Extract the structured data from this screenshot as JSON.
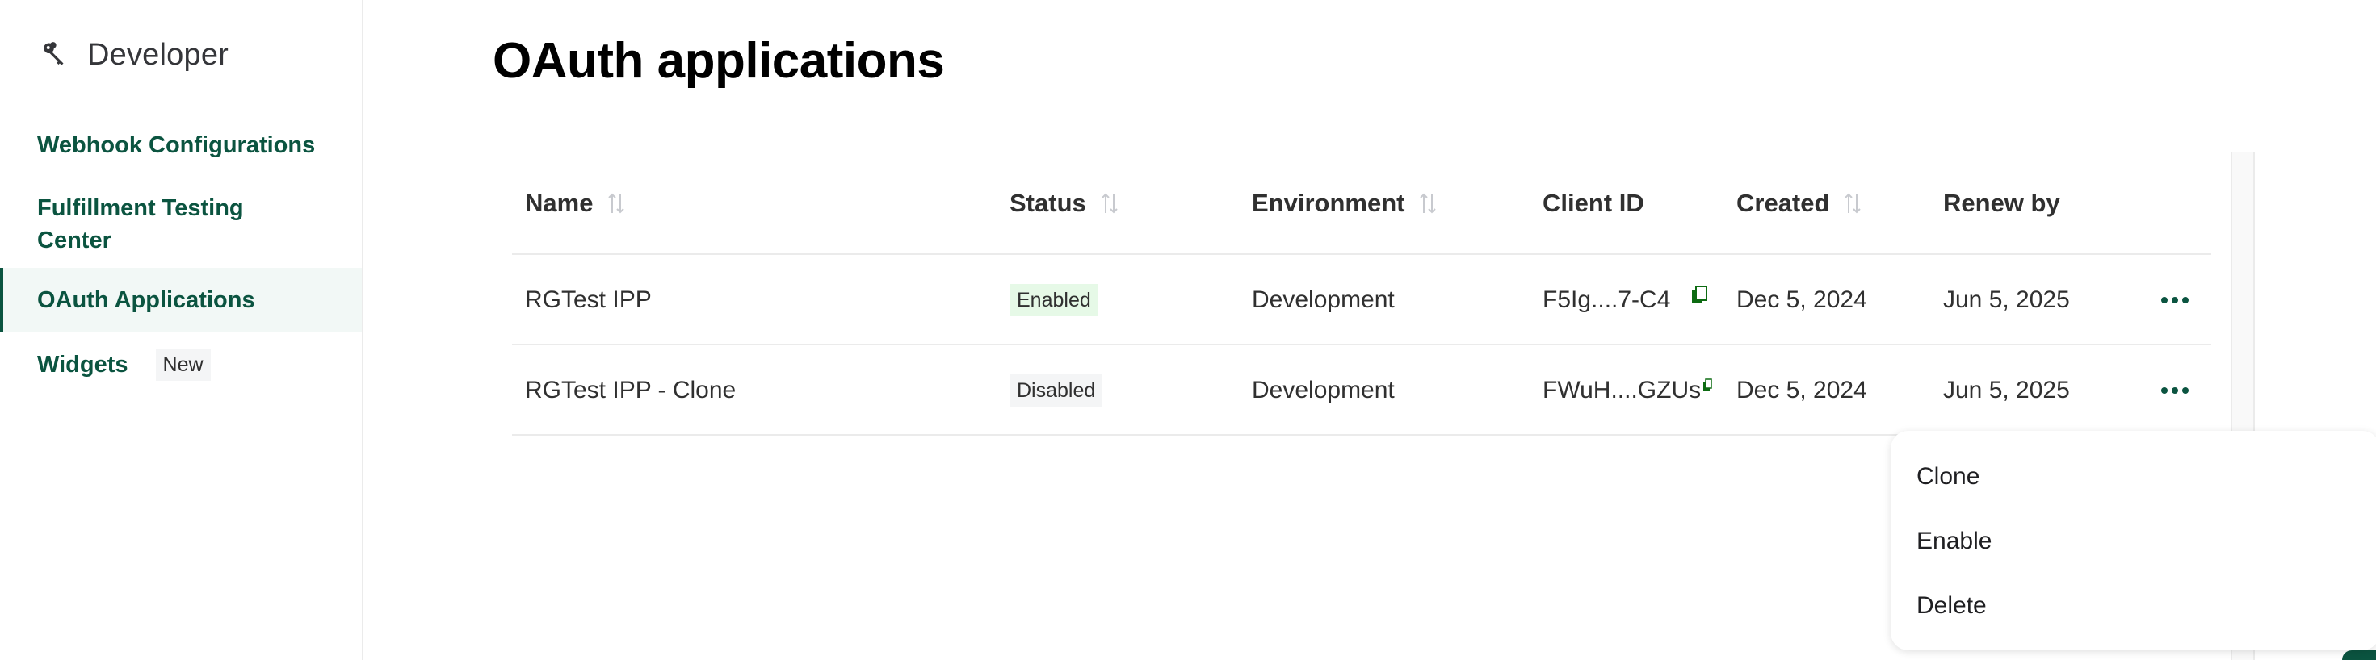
{
  "sidebar": {
    "brand_icon": "key-icon",
    "title": "Developer",
    "items": [
      {
        "label": "Webhook Configurations",
        "active": false
      },
      {
        "label": "Fulfillment Testing Center",
        "active": false
      },
      {
        "label": "OAuth Applications",
        "active": true
      },
      {
        "label": "Widgets",
        "active": false,
        "badge": "New"
      }
    ]
  },
  "page": {
    "title": "OAuth applications"
  },
  "table": {
    "columns": [
      {
        "label": "Name",
        "sortable": true
      },
      {
        "label": "Status",
        "sortable": true
      },
      {
        "label": "Environment",
        "sortable": true
      },
      {
        "label": "Client ID",
        "sortable": false
      },
      {
        "label": "Created",
        "sortable": true
      },
      {
        "label": "Renew by",
        "sortable": false
      }
    ],
    "rows": [
      {
        "name": "RGTest IPP",
        "status": "Enabled",
        "environment": "Development",
        "client_id": "F5Ig....7-C4",
        "created": "Dec 5, 2024",
        "renew_by": "Jun 5, 2025"
      },
      {
        "name": "RGTest IPP - Clone",
        "status": "Disabled",
        "environment": "Development",
        "client_id": "FWuH....GZUs",
        "created": "Dec 5, 2024",
        "renew_by": "Jun 5, 2025"
      }
    ]
  },
  "row_menu": {
    "items": [
      "Clone",
      "Enable",
      "Delete"
    ]
  },
  "colors": {
    "brand_green": "#0b5440",
    "active_bg": "#f2f8f6",
    "enabled_badge_bg": "#e6f9e7",
    "disabled_badge_bg": "#f4f5f6",
    "copy_icon": "#0d6b12"
  }
}
